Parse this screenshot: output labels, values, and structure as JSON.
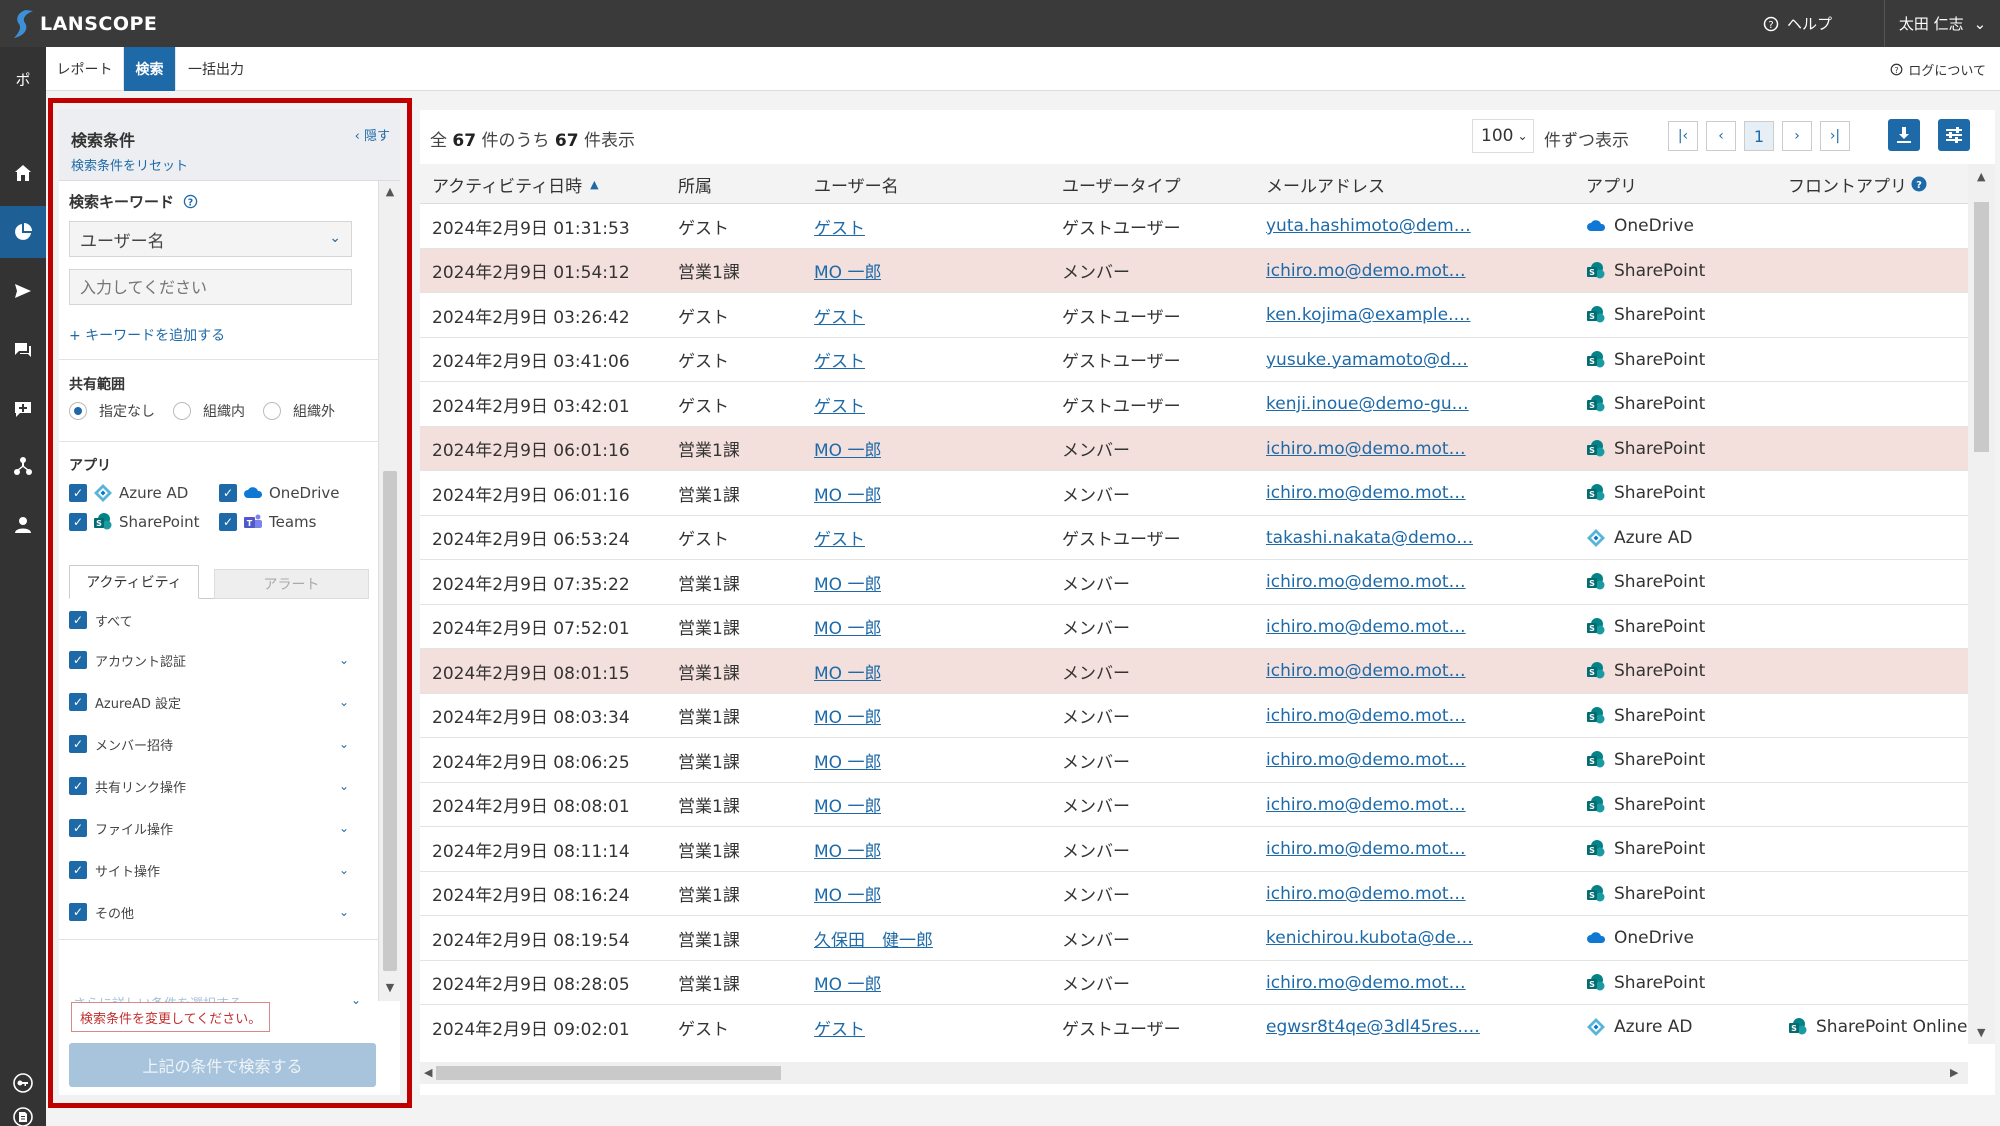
{
  "app": {
    "name": "LANSCOPE"
  },
  "topbar": {
    "help": "ヘルプ",
    "user": "太田 仁志"
  },
  "nav": {
    "top_label": "ポ"
  },
  "tabs": [
    {
      "label": "レポート"
    },
    {
      "label": "検索"
    },
    {
      "label": "一括出力"
    }
  ],
  "log_about": "ログについて",
  "panel": {
    "title": "検索条件",
    "reset": "検索条件をリセット",
    "hide": "隠す",
    "keyword_label": "検索キーワード",
    "keyword_select": "ユーザー名",
    "keyword_placeholder": "入力してください",
    "add_keyword": "+ キーワードを追加する",
    "share_label": "共有範囲",
    "share_options": [
      "指定なし",
      "組織内",
      "組織外"
    ],
    "app_label": "アプリ",
    "apps": [
      "Azure AD",
      "OneDrive",
      "SharePoint",
      "Teams"
    ],
    "subtabs": [
      "アクティビティ",
      "アラート"
    ],
    "activities": [
      "すべて",
      "アカウント認証",
      "AzureAD 設定",
      "メンバー招待",
      "共有リンク操作",
      "ファイル操作",
      "サイト操作",
      "その他"
    ],
    "more_conditions": "さらに詳しい条件を選択する",
    "tooltip": "検索条件を変更してください。",
    "search_button": "上記の条件で検索する"
  },
  "results": {
    "count_prefix": "全",
    "total": "67",
    "count_mid": "件のうち",
    "shown": "67",
    "count_suffix": "件表示",
    "per_page": "100",
    "per_page_label": "件ずつ表示",
    "page": "1",
    "columns": [
      "アクティビティ日時",
      "所属",
      "ユーザー名",
      "ユーザータイプ",
      "メールアドレス",
      "アプリ",
      "フロントアプリ"
    ],
    "rows": [
      {
        "datetime": "2024年2月9日 01:31:53",
        "dept": "ゲスト",
        "user": "ゲスト",
        "type": "ゲストユーザー",
        "email": "yuta.hashimoto@dem…",
        "app": "OneDrive",
        "front": "",
        "hl": false
      },
      {
        "datetime": "2024年2月9日 01:54:12",
        "dept": "営業1課",
        "user": "MO 一郎",
        "type": "メンバー",
        "email": "ichiro.mo@demo.mot…",
        "app": "SharePoint",
        "front": "",
        "hl": true
      },
      {
        "datetime": "2024年2月9日 03:26:42",
        "dept": "ゲスト",
        "user": "ゲスト",
        "type": "ゲストユーザー",
        "email": "ken.kojima@example.…",
        "app": "SharePoint",
        "front": "",
        "hl": false
      },
      {
        "datetime": "2024年2月9日 03:41:06",
        "dept": "ゲスト",
        "user": "ゲスト",
        "type": "ゲストユーザー",
        "email": "yusuke.yamamoto@d…",
        "app": "SharePoint",
        "front": "",
        "hl": false
      },
      {
        "datetime": "2024年2月9日 03:42:01",
        "dept": "ゲスト",
        "user": "ゲスト",
        "type": "ゲストユーザー",
        "email": "kenji.inoue@demo-gu…",
        "app": "SharePoint",
        "front": "",
        "hl": false
      },
      {
        "datetime": "2024年2月9日 06:01:16",
        "dept": "営業1課",
        "user": "MO 一郎",
        "type": "メンバー",
        "email": "ichiro.mo@demo.mot…",
        "app": "SharePoint",
        "front": "",
        "hl": true
      },
      {
        "datetime": "2024年2月9日 06:01:16",
        "dept": "営業1課",
        "user": "MO 一郎",
        "type": "メンバー",
        "email": "ichiro.mo@demo.mot…",
        "app": "SharePoint",
        "front": "",
        "hl": false
      },
      {
        "datetime": "2024年2月9日 06:53:24",
        "dept": "ゲスト",
        "user": "ゲスト",
        "type": "ゲストユーザー",
        "email": "takashi.nakata@demo…",
        "app": "Azure AD",
        "front": "",
        "hl": false
      },
      {
        "datetime": "2024年2月9日 07:35:22",
        "dept": "営業1課",
        "user": "MO 一郎",
        "type": "メンバー",
        "email": "ichiro.mo@demo.mot…",
        "app": "SharePoint",
        "front": "",
        "hl": false
      },
      {
        "datetime": "2024年2月9日 07:52:01",
        "dept": "営業1課",
        "user": "MO 一郎",
        "type": "メンバー",
        "email": "ichiro.mo@demo.mot…",
        "app": "SharePoint",
        "front": "",
        "hl": false
      },
      {
        "datetime": "2024年2月9日 08:01:15",
        "dept": "営業1課",
        "user": "MO 一郎",
        "type": "メンバー",
        "email": "ichiro.mo@demo.mot…",
        "app": "SharePoint",
        "front": "",
        "hl": true
      },
      {
        "datetime": "2024年2月9日 08:03:34",
        "dept": "営業1課",
        "user": "MO 一郎",
        "type": "メンバー",
        "email": "ichiro.mo@demo.mot…",
        "app": "SharePoint",
        "front": "",
        "hl": false
      },
      {
        "datetime": "2024年2月9日 08:06:25",
        "dept": "営業1課",
        "user": "MO 一郎",
        "type": "メンバー",
        "email": "ichiro.mo@demo.mot…",
        "app": "SharePoint",
        "front": "",
        "hl": false
      },
      {
        "datetime": "2024年2月9日 08:08:01",
        "dept": "営業1課",
        "user": "MO 一郎",
        "type": "メンバー",
        "email": "ichiro.mo@demo.mot…",
        "app": "SharePoint",
        "front": "",
        "hl": false
      },
      {
        "datetime": "2024年2月9日 08:11:14",
        "dept": "営業1課",
        "user": "MO 一郎",
        "type": "メンバー",
        "email": "ichiro.mo@demo.mot…",
        "app": "SharePoint",
        "front": "",
        "hl": false
      },
      {
        "datetime": "2024年2月9日 08:16:24",
        "dept": "営業1課",
        "user": "MO 一郎",
        "type": "メンバー",
        "email": "ichiro.mo@demo.mot…",
        "app": "SharePoint",
        "front": "",
        "hl": false
      },
      {
        "datetime": "2024年2月9日 08:19:54",
        "dept": "営業1課",
        "user": "久保田　健一郎",
        "type": "メンバー",
        "email": "kenichirou.kubota@de…",
        "app": "OneDrive",
        "front": "",
        "hl": false
      },
      {
        "datetime": "2024年2月9日 08:28:05",
        "dept": "営業1課",
        "user": "MO 一郎",
        "type": "メンバー",
        "email": "ichiro.mo@demo.mot…",
        "app": "SharePoint",
        "front": "",
        "hl": false
      },
      {
        "datetime": "2024年2月9日 09:02:01",
        "dept": "ゲスト",
        "user": "ゲスト",
        "type": "ゲストユーザー",
        "email": "egwsr8t4qe@3dl45res.…",
        "app": "Azure AD",
        "front": "SharePoint Online",
        "hl": false
      }
    ]
  },
  "colors": {
    "accent": "#1e6aa8",
    "highlight_row": "#f3dfdb",
    "frame": "#c00000",
    "topbar": "#3a3a3a"
  }
}
